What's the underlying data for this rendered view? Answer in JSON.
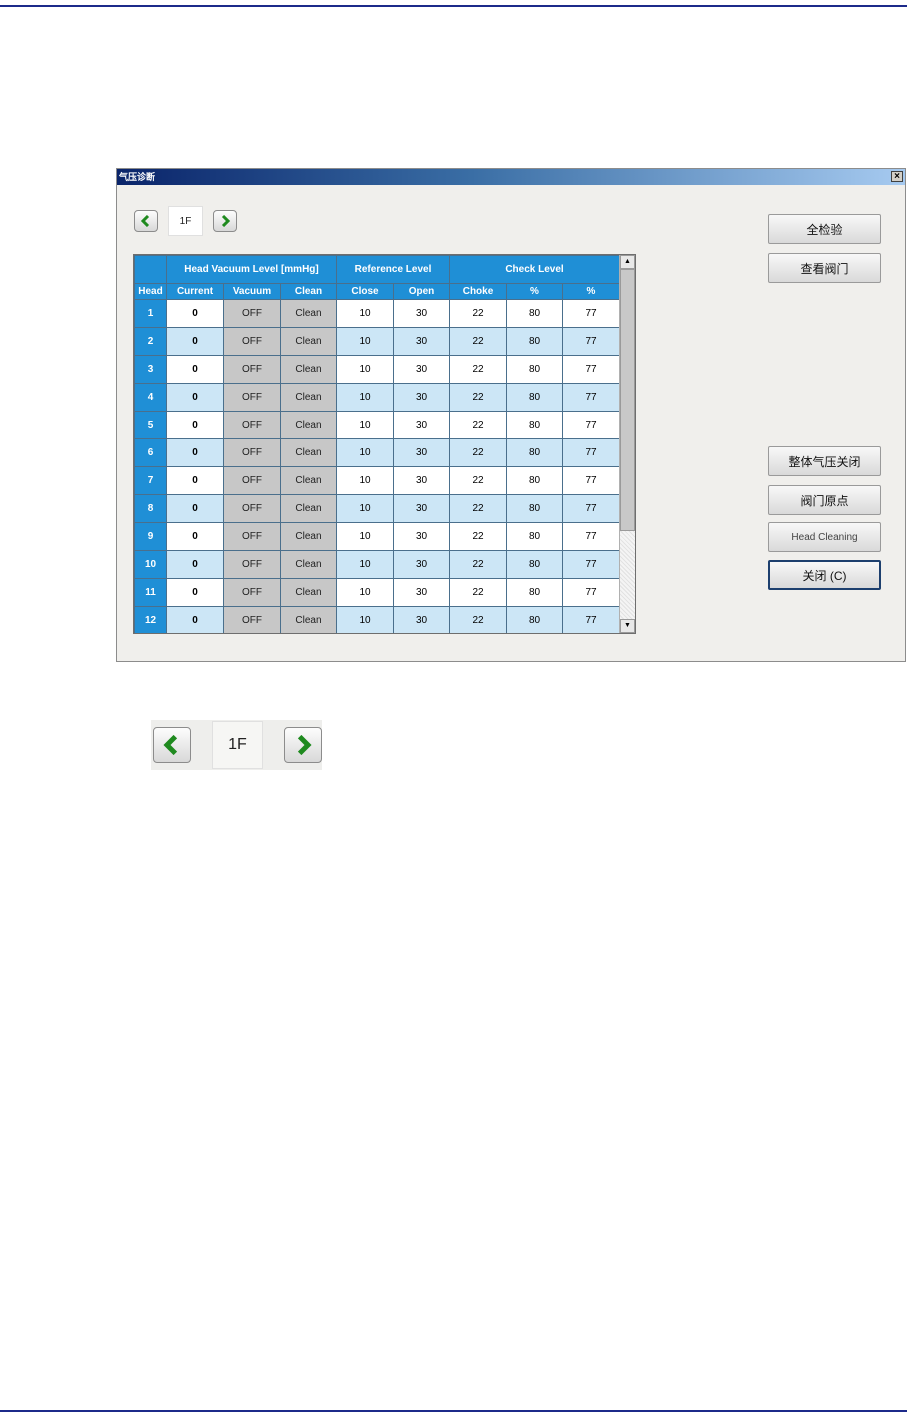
{
  "window": {
    "title": "气压诊断",
    "close_glyph": "×"
  },
  "floor_nav": {
    "value": "1F",
    "prev_icon": "chevron-left-icon",
    "next_icon": "chevron-right-icon"
  },
  "table": {
    "group_headers": [
      "Head Vacuum Level [mmHg]",
      "Reference Level",
      "Check Level"
    ],
    "columns": [
      "Head",
      "Current",
      "Vacuum",
      "Clean",
      "Close",
      "Open",
      "Choke",
      "%",
      "%"
    ],
    "rows": [
      {
        "head": "1",
        "current": "0",
        "vacuum": "OFF",
        "clean": "Clean",
        "close": "10",
        "open": "30",
        "choke": "22",
        "pct1": "80",
        "pct2": "77"
      },
      {
        "head": "2",
        "current": "0",
        "vacuum": "OFF",
        "clean": "Clean",
        "close": "10",
        "open": "30",
        "choke": "22",
        "pct1": "80",
        "pct2": "77"
      },
      {
        "head": "3",
        "current": "0",
        "vacuum": "OFF",
        "clean": "Clean",
        "close": "10",
        "open": "30",
        "choke": "22",
        "pct1": "80",
        "pct2": "77"
      },
      {
        "head": "4",
        "current": "0",
        "vacuum": "OFF",
        "clean": "Clean",
        "close": "10",
        "open": "30",
        "choke": "22",
        "pct1": "80",
        "pct2": "77"
      },
      {
        "head": "5",
        "current": "0",
        "vacuum": "OFF",
        "clean": "Clean",
        "close": "10",
        "open": "30",
        "choke": "22",
        "pct1": "80",
        "pct2": "77"
      },
      {
        "head": "6",
        "current": "0",
        "vacuum": "OFF",
        "clean": "Clean",
        "close": "10",
        "open": "30",
        "choke": "22",
        "pct1": "80",
        "pct2": "77"
      },
      {
        "head": "7",
        "current": "0",
        "vacuum": "OFF",
        "clean": "Clean",
        "close": "10",
        "open": "30",
        "choke": "22",
        "pct1": "80",
        "pct2": "77"
      },
      {
        "head": "8",
        "current": "0",
        "vacuum": "OFF",
        "clean": "Clean",
        "close": "10",
        "open": "30",
        "choke": "22",
        "pct1": "80",
        "pct2": "77"
      },
      {
        "head": "9",
        "current": "0",
        "vacuum": "OFF",
        "clean": "Clean",
        "close": "10",
        "open": "30",
        "choke": "22",
        "pct1": "80",
        "pct2": "77"
      },
      {
        "head": "10",
        "current": "0",
        "vacuum": "OFF",
        "clean": "Clean",
        "close": "10",
        "open": "30",
        "choke": "22",
        "pct1": "80",
        "pct2": "77"
      },
      {
        "head": "11",
        "current": "0",
        "vacuum": "OFF",
        "clean": "Clean",
        "close": "10",
        "open": "30",
        "choke": "22",
        "pct1": "80",
        "pct2": "77"
      },
      {
        "head": "12",
        "current": "0",
        "vacuum": "OFF",
        "clean": "Clean",
        "close": "10",
        "open": "30",
        "choke": "22",
        "pct1": "80",
        "pct2": "77"
      }
    ]
  },
  "buttons": {
    "check_all": "全检验",
    "view_valve": "查看阀门",
    "all_air_off": "整体气压关闭",
    "valve_origin": "阀门原点",
    "head_cleaning": "Head Cleaning",
    "close": "关闭 (C)"
  },
  "colors": {
    "header_blue": "#1f8fd6",
    "row_alt": "#cce6f6",
    "cell_gray": "#c7c7c7",
    "nav_arrow": "#1f8a1f"
  }
}
